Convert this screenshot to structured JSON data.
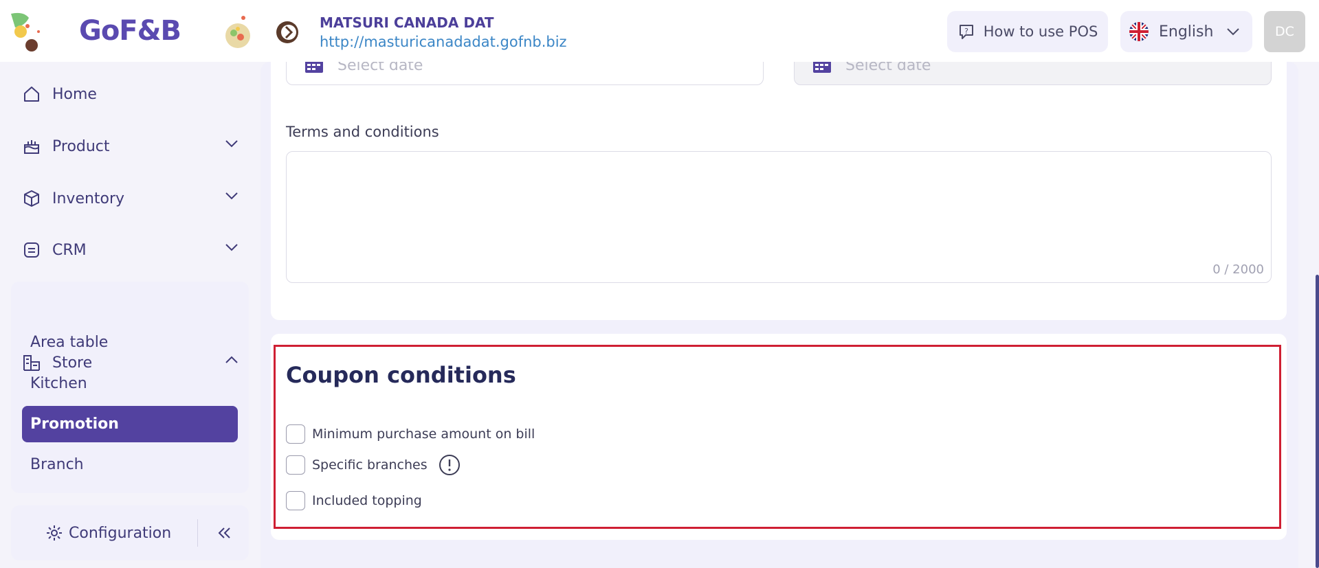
{
  "header": {
    "brand": "GoF&B",
    "store_name": "MATSURI CANADA DAT",
    "store_url": "http://masturicanadadat.gofnb.biz",
    "help_label": "How to use POS",
    "language": "English",
    "avatar_initials": "DC"
  },
  "sidebar": {
    "items": [
      {
        "label": "Home",
        "icon": "home-icon"
      },
      {
        "label": "Product",
        "icon": "product-icon"
      },
      {
        "label": "Inventory",
        "icon": "inventory-icon"
      },
      {
        "label": "CRM",
        "icon": "crm-icon"
      },
      {
        "label": "Store",
        "icon": "store-icon"
      }
    ],
    "store_sub_items": [
      "Area table",
      "Kitchen",
      "Promotion",
      "Branch"
    ],
    "active_item": "Promotion",
    "configuration_label": "Configuration"
  },
  "form": {
    "start_date_placeholder": "Select date",
    "end_date_placeholder": "Select date",
    "terms_label": "Terms and conditions",
    "terms_counter": "0 / 2000",
    "coupon_conditions_title": "Coupon conditions",
    "conditions": [
      {
        "label": "Minimum purchase amount on bill",
        "checked": false
      },
      {
        "label": "Specific branches",
        "checked": false
      },
      {
        "label": "Included topping",
        "checked": false
      }
    ]
  },
  "colors": {
    "primary": "#5342a0",
    "highlight_border": "#cf1f33",
    "url": "#3b86c6"
  }
}
